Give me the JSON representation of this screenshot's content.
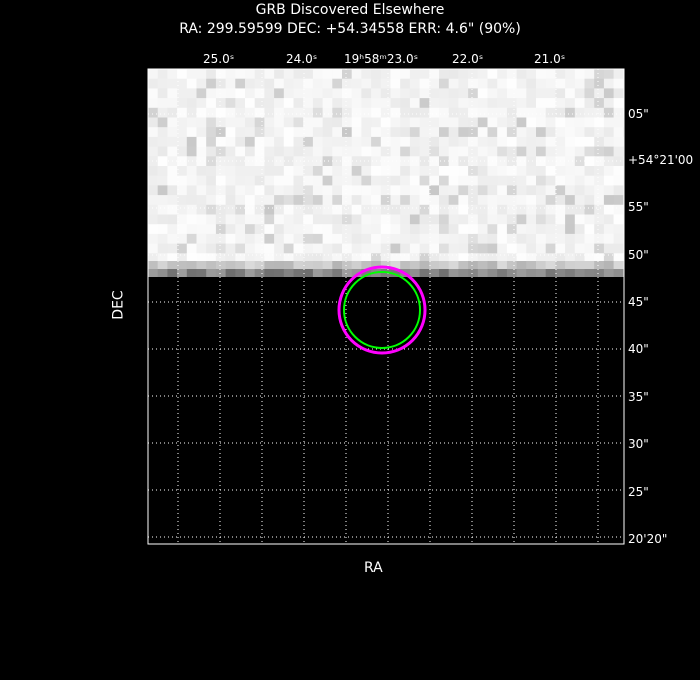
{
  "header": {
    "title": "GRB Discovered Elsewhere",
    "subtitle": "RA: 299.59599  DEC: +54.34558  ERR: 4.6\" (90%)"
  },
  "axes": {
    "xlabel": "RA",
    "ylabel": "DEC",
    "top_ticks": [
      {
        "label": "25.0ˢ"
      },
      {
        "label": "24.0ˢ"
      },
      {
        "label": "19ʰ58ᵐ23.0ˢ"
      },
      {
        "label": "22.0ˢ"
      },
      {
        "label": "21.0ˢ"
      }
    ],
    "right_ticks": [
      {
        "label": "05\""
      },
      {
        "label": "+54°21'00"
      },
      {
        "label": "55\""
      },
      {
        "label": "50\""
      },
      {
        "label": "45\""
      },
      {
        "label": "40\""
      },
      {
        "label": "35\""
      },
      {
        "label": "30\""
      },
      {
        "label": "25\""
      },
      {
        "label": "20'20\""
      }
    ]
  },
  "colors": {
    "outer_circle": "#ff00ff",
    "inner_circle": "#00ff00",
    "grid": "#ffffff"
  }
}
